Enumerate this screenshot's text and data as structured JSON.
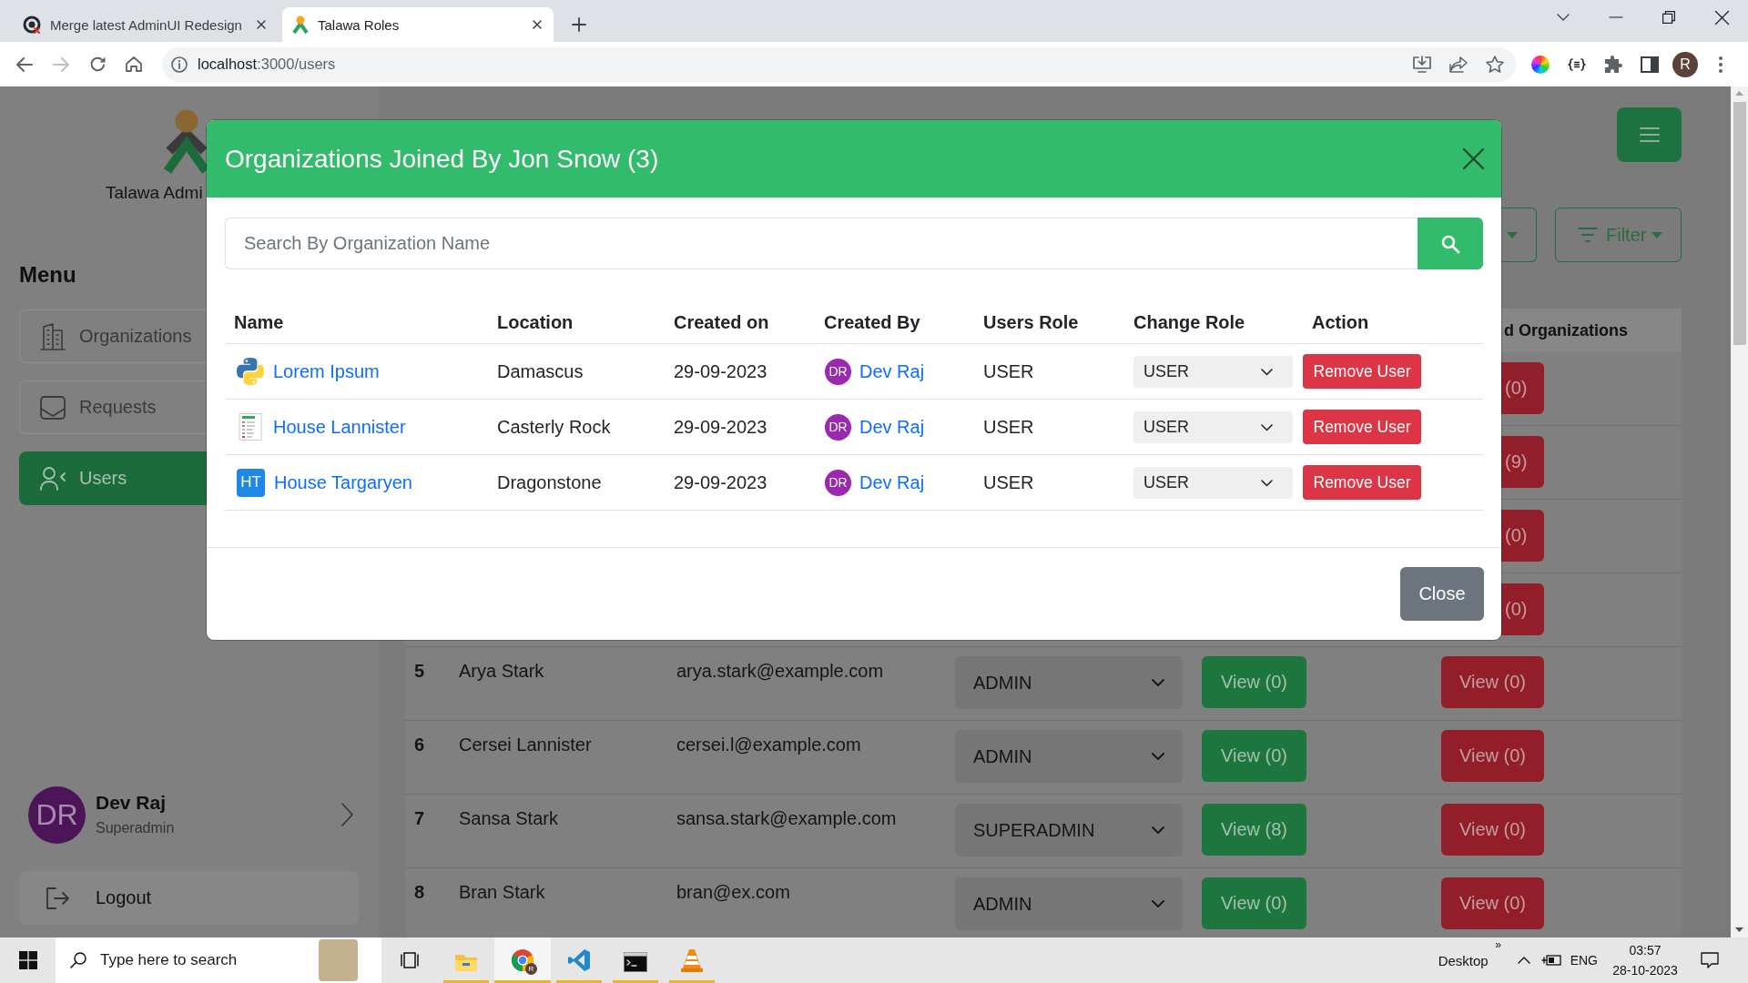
{
  "browser": {
    "tabs": [
      {
        "kind": "repo",
        "title": "Merge latest AdminUI Redesign",
        "selected": false
      },
      {
        "kind": "app",
        "title": "Talawa Roles",
        "selected": true
      }
    ],
    "url": {
      "host": "localhost",
      "path": ":3000/users"
    },
    "profile_initial": "R"
  },
  "sidebar": {
    "brand": "Talawa Admi",
    "menu_title": "Menu",
    "items": [
      {
        "kind": "organizations",
        "label": "Organizations",
        "selected": false
      },
      {
        "kind": "requests",
        "label": "Requests",
        "selected": false
      },
      {
        "kind": "users",
        "label": "Users",
        "selected": true
      }
    ],
    "profile": {
      "initials": "DR",
      "name": "Dev Raj",
      "role": "Superadmin"
    },
    "logout": "Logout"
  },
  "main": {
    "filter_button": "Filter",
    "table": {
      "header": "d Organizations",
      "rows": [
        {
          "kind": "covered",
          "column_6": "(0)"
        },
        {
          "kind": "covered",
          "column_6": "(9)"
        },
        {
          "kind": "covered",
          "column_6": "(0)"
        },
        {
          "kind": "covered",
          "column_6": "(0)"
        },
        {
          "kind": "full",
          "number": "5",
          "name": "Arya Stark",
          "email": "arya.stark@example.com",
          "role": "ADMIN",
          "column_5": "View (0)",
          "column_6": "View (0)"
        },
        {
          "kind": "full",
          "number": "6",
          "name": "Cersei Lannister",
          "email": "cersei.l@example.com",
          "role": "ADMIN",
          "column_5": "View (0)",
          "column_6": "View (0)"
        },
        {
          "kind": "full",
          "number": "7",
          "name": "Sansa Stark",
          "email": "sansa.stark@example.com",
          "role": "SUPERADMIN",
          "column_5": "View (8)",
          "column_6": "View (0)"
        },
        {
          "kind": "full",
          "number": "8",
          "name": "Bran Stark",
          "email": "bran@ex.com",
          "role": "ADMIN",
          "column_5": "View (0)",
          "column_6": "View (0)"
        }
      ]
    }
  },
  "modal": {
    "title": "Organizations Joined By Jon Snow (3)",
    "search": {
      "placeholder": "Search By Organization Name"
    },
    "columns": [
      "Name",
      "Location",
      "Created on",
      "Created By",
      "Users Role",
      "Change Role",
      "Action"
    ],
    "rows": [
      {
        "avatar": {
          "kind": "logo"
        },
        "name": "Lorem Ipsum",
        "location": "Damascus",
        "created_on": "29-09-2023",
        "creator": {
          "initials": "DR",
          "name": "Dev Raj"
        },
        "users_role": "USER",
        "change_role": "USER",
        "action": "Remove User"
      },
      {
        "avatar": {
          "kind": "thumbnail"
        },
        "name": "House Lannister",
        "location": "Casterly Rock",
        "created_on": "29-09-2023",
        "creator": {
          "initials": "DR",
          "name": "Dev Raj"
        },
        "users_role": "USER",
        "change_role": "USER",
        "action": "Remove User"
      },
      {
        "avatar": {
          "kind": "initials",
          "text": "HT"
        },
        "name": "House Targaryen",
        "location": "Dragonstone",
        "created_on": "29-09-2023",
        "creator": {
          "initials": "DR",
          "name": "Dev Raj"
        },
        "users_role": "USER",
        "change_role": "USER",
        "action": "Remove User"
      }
    ],
    "close_button": "Close"
  },
  "taskbar": {
    "search": {
      "placeholder": "Type here to search"
    },
    "apps": [
      {
        "kind": "files",
        "running": true,
        "active": false
      },
      {
        "kind": "browser",
        "running": true,
        "active": true,
        "badge": "R"
      },
      {
        "kind": "editor",
        "running": true,
        "active": false
      },
      {
        "kind": "terminal",
        "running": true,
        "active": false
      },
      {
        "kind": "player",
        "running": true,
        "active": false
      }
    ],
    "overflow": "»",
    "desktop": "Desktop",
    "language": "ENG",
    "time": "03:57",
    "date": "28-10-2023"
  }
}
